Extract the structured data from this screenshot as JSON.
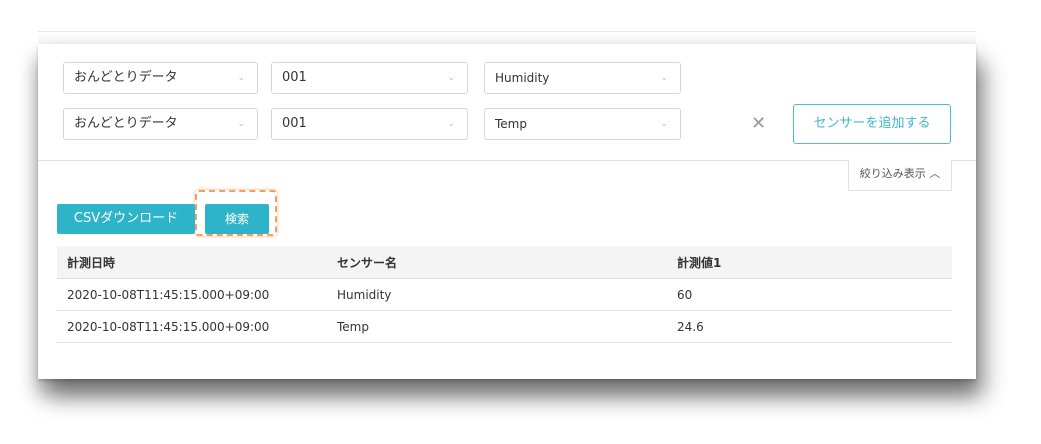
{
  "filters": [
    {
      "data_source": "おんどとりデータ",
      "device": "001",
      "sensor": "Humidity"
    },
    {
      "data_source": "おんどとりデータ",
      "device": "001",
      "sensor": "Temp"
    }
  ],
  "remove_icon": "close-icon",
  "add_sensor_label": "センサーを追加する",
  "filter_toggle_label": "絞り込み表示 ︿",
  "csv_button_label": "CSVダウンロード",
  "search_button_label": "検索",
  "table": {
    "headers": [
      "計測日時",
      "センサー名",
      "計測値1"
    ],
    "rows": [
      [
        "2020-10-08T11:45:15.000+09:00",
        "Humidity",
        "60"
      ],
      [
        "2020-10-08T11:45:15.000+09:00",
        "Temp",
        "24.6"
      ]
    ]
  },
  "colors": {
    "accent": "#2db4c9",
    "highlight": "#f0a060"
  }
}
